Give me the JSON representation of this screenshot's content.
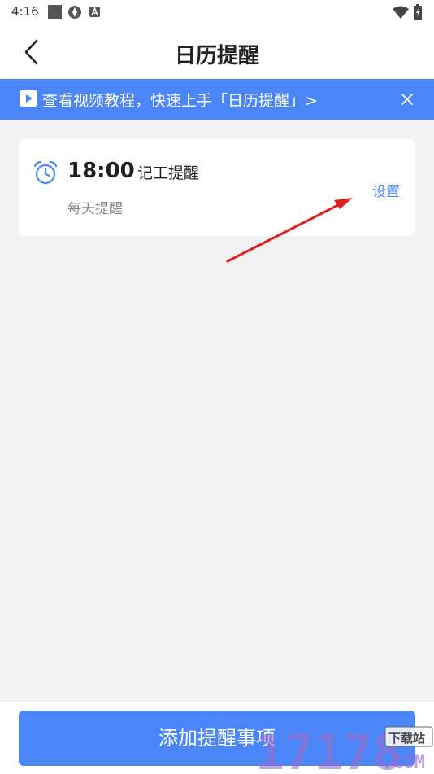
{
  "status_bar": {
    "time": "4:16"
  },
  "app_bar": {
    "title": "日历提醒"
  },
  "banner": {
    "text": "查看视频教程，快速上手「日历提醒」>"
  },
  "reminder": {
    "time": "18:00",
    "name": "记工提醒",
    "frequency": "每天提醒",
    "settings_label": "设置"
  },
  "bottom": {
    "add_button_label": "添加提醒事项"
  },
  "watermark": {
    "number": "17178",
    "label": "下载站",
    "suffix": ".COM"
  },
  "colors": {
    "primary": "#4a86f7",
    "background": "#f2f2f2",
    "annotation_arrow": "#e02020",
    "watermark": "#9a6cc9"
  }
}
